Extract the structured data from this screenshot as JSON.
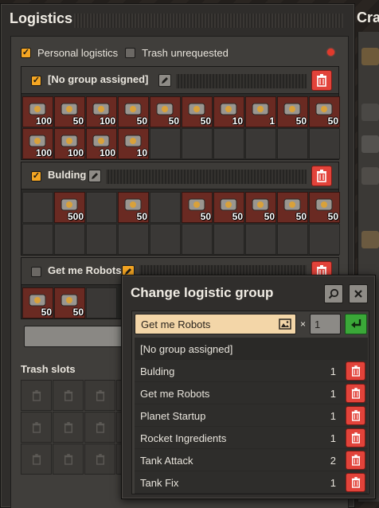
{
  "logistics": {
    "title": "Logistics",
    "personal_logistics_label": "Personal logistics",
    "personal_logistics_checked": true,
    "trash_unrequested_label": "Trash unrequested",
    "trash_unrequested_checked": false,
    "status_dot_color": "#e03a2c",
    "groups": [
      {
        "name": "[No group assigned]",
        "checked": true,
        "slots": [
          {
            "icon": "wrench-icon",
            "count": "100"
          },
          {
            "icon": "power-pole-icon",
            "count": "50"
          },
          {
            "icon": "small-pole-icon",
            "count": "100"
          },
          {
            "icon": "laser-turret-icon",
            "count": "50"
          },
          {
            "icon": "inserter-icon",
            "count": "50"
          },
          {
            "icon": "lab-icon",
            "count": "50"
          },
          {
            "icon": "long-inserter-icon",
            "count": "10"
          },
          {
            "icon": "car-icon",
            "count": "1"
          },
          {
            "icon": "wall-icon",
            "count": "50"
          },
          {
            "icon": "gun-turret-icon",
            "count": "50"
          },
          {
            "icon": "pipe-icon",
            "count": "100"
          },
          {
            "icon": "underground-pipe-icon",
            "count": "100"
          },
          {
            "icon": "rail-icon",
            "count": "100"
          },
          {
            "icon": "pump-icon",
            "count": "10"
          },
          {
            "icon": "",
            "count": ""
          },
          {
            "icon": "",
            "count": ""
          },
          {
            "icon": "",
            "count": ""
          },
          {
            "icon": "",
            "count": ""
          },
          {
            "icon": "",
            "count": ""
          },
          {
            "icon": "",
            "count": ""
          }
        ]
      },
      {
        "name": "Bulding",
        "checked": true,
        "slots": [
          {
            "icon": "",
            "count": ""
          },
          {
            "icon": "transport-belt-icon",
            "count": "500"
          },
          {
            "icon": "",
            "count": ""
          },
          {
            "icon": "boiler-icon",
            "count": "50"
          },
          {
            "icon": "",
            "count": ""
          },
          {
            "icon": "fast-inserter-icon",
            "count": "50"
          },
          {
            "icon": "stack-inserter-icon",
            "count": "50"
          },
          {
            "icon": "filter-inserter-icon",
            "count": "50"
          },
          {
            "icon": "bulk-inserter-icon",
            "count": "50"
          },
          {
            "icon": "assembler-icon",
            "count": "50"
          },
          {
            "icon": "",
            "count": ""
          },
          {
            "icon": "",
            "count": ""
          },
          {
            "icon": "",
            "count": ""
          },
          {
            "icon": "",
            "count": ""
          },
          {
            "icon": "",
            "count": ""
          },
          {
            "icon": "",
            "count": ""
          },
          {
            "icon": "",
            "count": ""
          },
          {
            "icon": "",
            "count": ""
          },
          {
            "icon": "",
            "count": ""
          },
          {
            "icon": "",
            "count": ""
          }
        ]
      },
      {
        "name": "Get me Robots",
        "checked": false,
        "slots": [
          {
            "icon": "construction-robot-icon",
            "count": "50"
          },
          {
            "icon": "logistic-robot-icon",
            "count": "50"
          },
          {
            "icon": "",
            "count": ""
          }
        ]
      }
    ],
    "trash_slots_label": "Trash slots"
  },
  "crafting": {
    "title_partial": "Craf"
  },
  "popup": {
    "title": "Change logistic group",
    "search_value": "Get me Robots",
    "times_label": "×",
    "quantity": "1",
    "groups": [
      {
        "name": "[No group assigned]",
        "count": ""
      },
      {
        "name": "Bulding",
        "count": "1"
      },
      {
        "name": "Get me Robots",
        "count": "1"
      },
      {
        "name": "Planet Startup",
        "count": "1"
      },
      {
        "name": "Rocket Ingredients",
        "count": "1"
      },
      {
        "name": "Tank Attack",
        "count": "2"
      },
      {
        "name": "Tank Fix",
        "count": "1"
      }
    ]
  },
  "colors": {
    "accent": "#f5a623",
    "danger": "#e2433a",
    "confirm": "#3aa838",
    "slot_filled": "#6a2a22"
  }
}
